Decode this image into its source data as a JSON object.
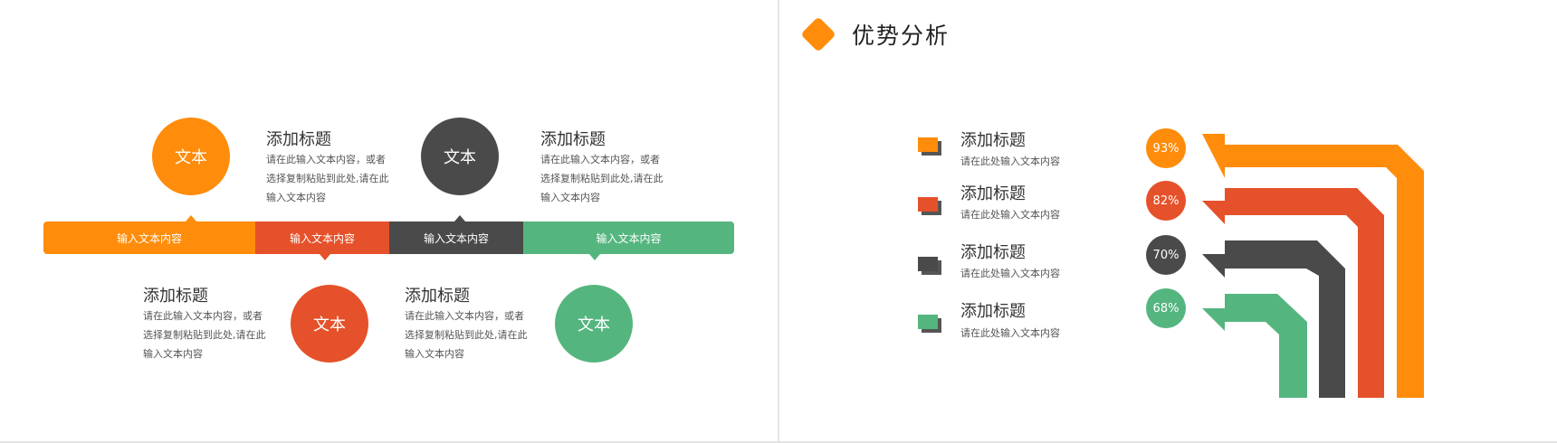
{
  "colors": {
    "orange": "#FF8C0A",
    "red": "#E5512A",
    "dark": "#4A4A4A",
    "green": "#55B57F"
  },
  "left_slide": {
    "items": [
      {
        "circle_label": "文本",
        "title": "添加标题",
        "desc": "请在此输入文本内容，或者选择复制粘贴到此处,请在此输入文本内容",
        "bar_label": "输入文本内容"
      },
      {
        "circle_label": "文本",
        "title": "添加标题",
        "desc": "请在此输入文本内容，或者选择复制粘贴到此处,请在此输入文本内容",
        "bar_label": "输入文本内容"
      },
      {
        "circle_label": "文本",
        "title": "添加标题",
        "desc": "请在此输入文本内容，或者选择复制粘贴到此处,请在此输入文本内容",
        "bar_label": "输入文本内容"
      },
      {
        "circle_label": "文本",
        "title": "添加标题",
        "desc": "请在此输入文本内容，或者选择复制粘贴到此处,请在此输入文本内容",
        "bar_label": "输入文本内容"
      }
    ]
  },
  "right_slide": {
    "title": "优势分析",
    "rows": [
      {
        "title": "添加标题",
        "desc": "请在此处输入文本内容",
        "percent": "93%",
        "value": 93
      },
      {
        "title": "添加标题",
        "desc": "请在此处输入文本内容",
        "percent": "82%",
        "value": 82
      },
      {
        "title": "添加标题",
        "desc": "请在此处输入文本内容",
        "percent": "70%",
        "value": 70
      },
      {
        "title": "添加标题",
        "desc": "请在此处输入文本内容",
        "percent": "68%",
        "value": 68
      }
    ]
  }
}
